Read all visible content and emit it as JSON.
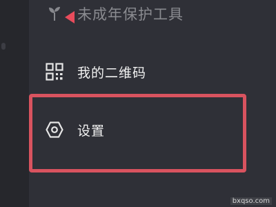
{
  "menu": {
    "minor_protection": {
      "label": "未成年保护工具",
      "icon": "sprout-icon"
    },
    "qr_code": {
      "label": "我的二维码",
      "icon": "qr-code-icon"
    },
    "settings": {
      "label": "设置",
      "icon": "settings-hexagon-icon"
    }
  },
  "annotations": {
    "highlight_color": "#d9535f",
    "arrow_color": "#e84c5c"
  },
  "watermark": {
    "text": "bxqso.com"
  }
}
